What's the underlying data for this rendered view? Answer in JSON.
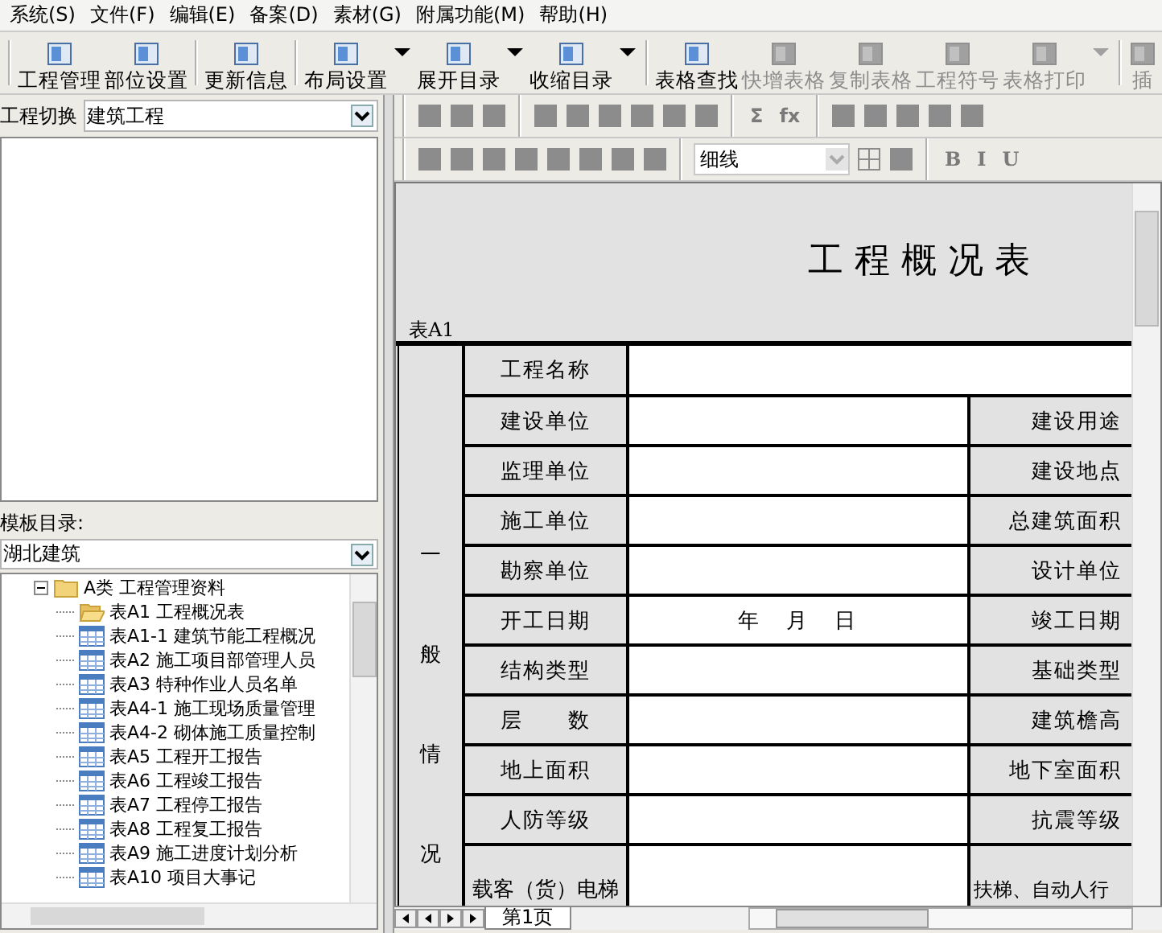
{
  "menu": [
    "系统(S)",
    "文件(F)",
    "编辑(E)",
    "备案(D)",
    "素材(G)",
    "附属功能(M)",
    "帮助(H)"
  ],
  "toolbar": [
    {
      "label": "工程管理",
      "disabled": false,
      "dropdown": false,
      "group_start": true
    },
    {
      "label": "部位设置",
      "disabled": false,
      "dropdown": false,
      "group_start": false
    },
    {
      "label": "更新信息",
      "disabled": false,
      "dropdown": false,
      "group_start": true
    },
    {
      "label": "布局设置",
      "disabled": false,
      "dropdown": true,
      "group_start": true
    },
    {
      "label": "展开目录",
      "disabled": false,
      "dropdown": true,
      "group_start": false
    },
    {
      "label": "收缩目录",
      "disabled": false,
      "dropdown": true,
      "group_start": false
    },
    {
      "label": "表格查找",
      "disabled": false,
      "dropdown": false,
      "group_start": true
    },
    {
      "label": "快增表格",
      "disabled": true,
      "dropdown": false,
      "group_start": false
    },
    {
      "label": "复制表格",
      "disabled": true,
      "dropdown": false,
      "group_start": false
    },
    {
      "label": "工程符号",
      "disabled": true,
      "dropdown": false,
      "group_start": false
    },
    {
      "label": "表格打印",
      "disabled": true,
      "dropdown": true,
      "group_start": false
    },
    {
      "label": "插",
      "disabled": true,
      "dropdown": false,
      "group_start": true
    }
  ],
  "project_switch": {
    "label": "工程切换",
    "value": "建筑工程"
  },
  "template_dir": {
    "label": "模板目录:",
    "value": "湖北建筑"
  },
  "tree": [
    {
      "label": "A类  工程管理资料",
      "kind": "folder",
      "expanded": true,
      "children": [
        {
          "label": "表A1  工程概况表",
          "kind": "open-folder"
        },
        {
          "label": "表A1-1 建筑节能工程概况",
          "kind": "table"
        },
        {
          "label": "表A2 施工项目部管理人员",
          "kind": "table"
        },
        {
          "label": "表A3 特种作业人员名单",
          "kind": "table"
        },
        {
          "label": "表A4-1 施工现场质量管理",
          "kind": "table"
        },
        {
          "label": "表A4-2 砌体施工质量控制",
          "kind": "table"
        },
        {
          "label": "表A5 工程开工报告",
          "kind": "table"
        },
        {
          "label": "表A6 工程竣工报告",
          "kind": "table"
        },
        {
          "label": "表A7 工程停工报告",
          "kind": "table"
        },
        {
          "label": "表A8 工程复工报告",
          "kind": "table"
        },
        {
          "label": "表A9 施工进度计划分析",
          "kind": "table"
        },
        {
          "label": "表A10 项目大事记",
          "kind": "table"
        }
      ]
    }
  ],
  "format_toolbar_1": {
    "glyphs": [
      "Σ",
      "fx"
    ]
  },
  "format_toolbar_2": {
    "line_style": "细线",
    "glyphs": [
      "B",
      "I",
      "U"
    ]
  },
  "sheet": {
    "title": "工 程 概 况 表",
    "code": "表A1",
    "group_label": "一般情况",
    "rows": [
      {
        "label": "工程名称"
      },
      {
        "label": "建设单位",
        "right": "建设用途"
      },
      {
        "label": "监理单位",
        "right": "建设地点"
      },
      {
        "label": "施工单位",
        "right": "总建筑面积"
      },
      {
        "label": "勘察单位",
        "right": "设计单位"
      },
      {
        "label": "开工日期",
        "value": "年　月　日",
        "right": "竣工日期"
      },
      {
        "label": "结构类型",
        "right": "基础类型"
      },
      {
        "label": "层　　数",
        "right": "建筑檐高"
      },
      {
        "label": "地上面积",
        "right": "地下室面积"
      },
      {
        "label": "人防等级",
        "right": "抗震等级"
      },
      {
        "label": "载客（货）电梯",
        "right": "扶梯、自动人行"
      }
    ]
  },
  "sheet_tabs": [
    {
      "label": "第1页",
      "selected": true
    }
  ]
}
